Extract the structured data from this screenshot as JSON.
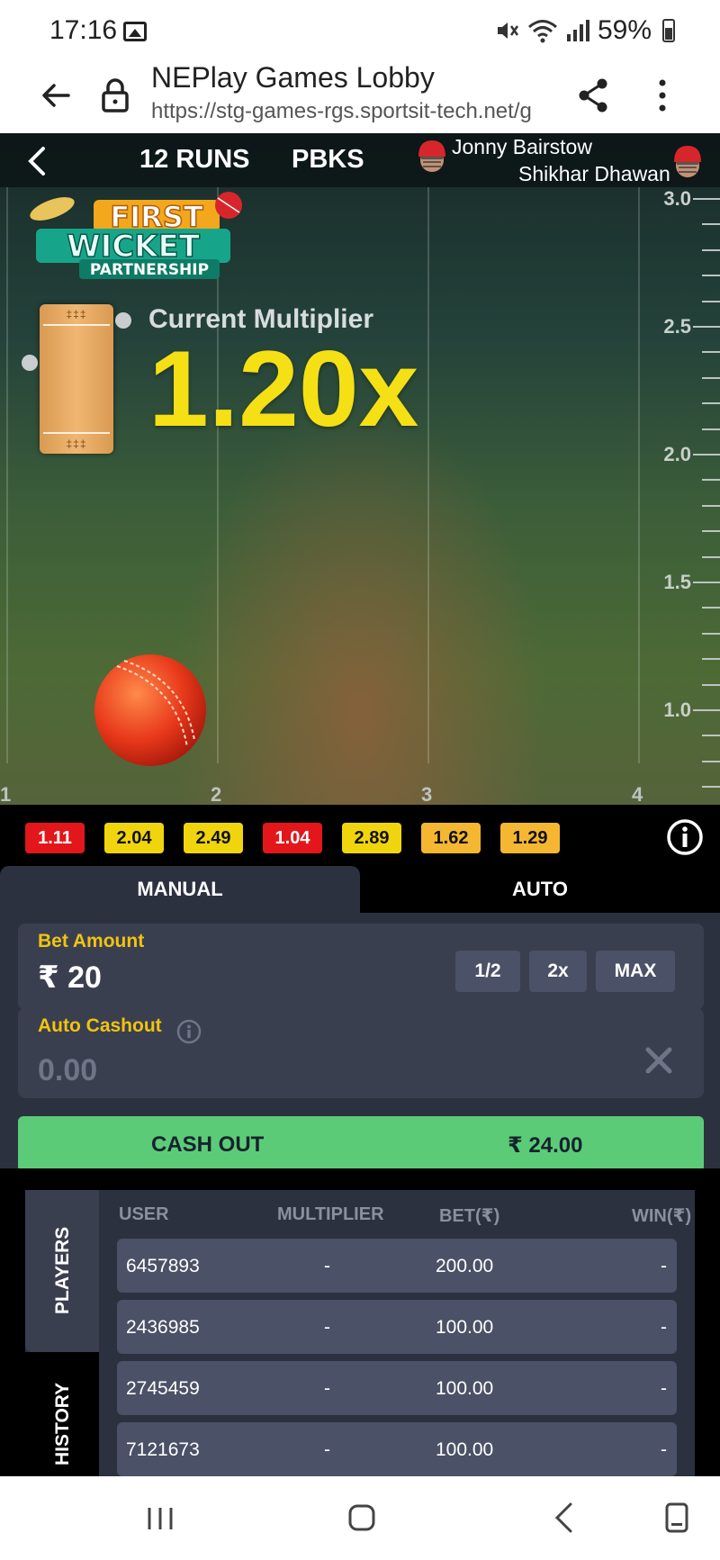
{
  "status_bar": {
    "time": "17:16",
    "battery": "59%",
    "icons": [
      "image-icon",
      "mute-icon",
      "wifi-icon",
      "signal-icon",
      "battery-icon"
    ]
  },
  "browser": {
    "title": "NEPlay Games Lobby",
    "url": "https://stg-games-rgs.sportsit-tech.net/g"
  },
  "game": {
    "runs": "12 RUNS",
    "team": "PBKS",
    "player_1": "Jonny Bairstow",
    "player_2": "Shikhar Dhawan",
    "logo_line_1": "FIRST",
    "logo_line_2": "WICKET",
    "logo_line_3": "PARTNERSHIP",
    "multiplier_label": "Current Multiplier",
    "multiplier_value": "1.20x",
    "x_ticks": [
      "1",
      "2",
      "3",
      "4"
    ],
    "y_ticks": [
      "3.0",
      "2.5",
      "2.0",
      "1.5",
      "1.0"
    ]
  },
  "recent": [
    {
      "value": "1.11",
      "color": "#e3171b"
    },
    {
      "value": "2.04",
      "color": "#f0d50e"
    },
    {
      "value": "2.49",
      "color": "#f0d50e"
    },
    {
      "value": "1.04",
      "color": "#e3171b"
    },
    {
      "value": "2.89",
      "color": "#f0d50e"
    },
    {
      "value": "1.62",
      "color": "#f5b731"
    },
    {
      "value": "1.29",
      "color": "#f5b731"
    }
  ],
  "tabs": {
    "manual": "MANUAL",
    "auto": "AUTO"
  },
  "bet": {
    "label": "Bet Amount",
    "value": "₹ 20",
    "half": "1/2",
    "double": "2x",
    "max": "MAX"
  },
  "auto_cashout": {
    "label": "Auto Cashout",
    "value": "0.00"
  },
  "cash_out": {
    "label": "CASH OUT",
    "amount": "₹ 24.00"
  },
  "players": {
    "side_tab_players": "PLAYERS",
    "side_tab_history": "HISTORY",
    "columns": [
      "USER",
      "MULTIPLIER",
      "BET(₹)",
      "WIN(₹)"
    ],
    "rows": [
      {
        "user": "6457893",
        "multiplier": "-",
        "bet": "200.00",
        "win": "-"
      },
      {
        "user": "2436985",
        "multiplier": "-",
        "bet": "100.00",
        "win": "-"
      },
      {
        "user": "2745459",
        "multiplier": "-",
        "bet": "100.00",
        "win": "-"
      },
      {
        "user": "7121673",
        "multiplier": "-",
        "bet": "100.00",
        "win": "-"
      }
    ]
  },
  "colors": {
    "accent_yellow": "#f5e015",
    "cashout_green": "#5ccb78",
    "panel_bg": "#2c3140"
  }
}
